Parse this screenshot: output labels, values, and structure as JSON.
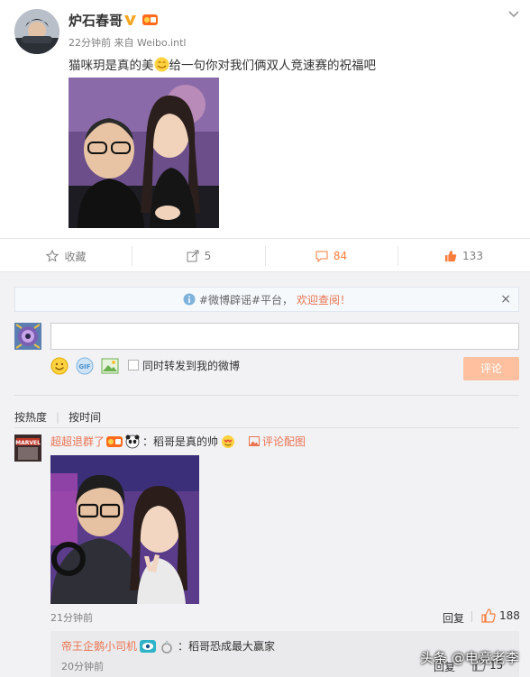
{
  "post": {
    "username": "炉石春哥",
    "meta": "22分钟前 来自 Weibo.intl",
    "text_before_emoji": "猫咪玥是真的美",
    "text_after_emoji": "给一句你对我们俩双人竞速赛的祝福吧",
    "icons": [
      "verified-v-icon",
      "vip-badge-icon",
      "chevron-down-icon",
      "smile-emoji-icon"
    ]
  },
  "actions": {
    "favorite_label": "收藏",
    "repost_count": "5",
    "comment_count": "84",
    "like_count": "133",
    "active_color": "#fa7d3c"
  },
  "notice": {
    "text": "#微博辟谣#平台，",
    "link": "欢迎查阅！",
    "close": "×"
  },
  "composer": {
    "input_value": "",
    "repost_label": "同时转发到我的微博",
    "submit_label": "评论",
    "tools": [
      "emoji-icon",
      "gif-icon",
      "image-icon"
    ]
  },
  "sort": {
    "hot": "按热度",
    "time": "按时间"
  },
  "comment": {
    "user": "超超退群了",
    "text": "：稻哥是真的帅",
    "reply_pic": "评论配图",
    "time": "21分钟前",
    "reply_label": "回复",
    "like_count": "188"
  },
  "sub_comment": {
    "user": "帝王企鹅小司机",
    "text": "：稻哥恐成最大赢家",
    "time": "20分钟前",
    "reply_label": "回复",
    "like_count": "15"
  },
  "watermark": "头条 @电竞老李",
  "colors": {
    "link_orange": "#eb7350",
    "submit_disabled": "#ffc09f",
    "background_gray": "#f2f2f5"
  }
}
